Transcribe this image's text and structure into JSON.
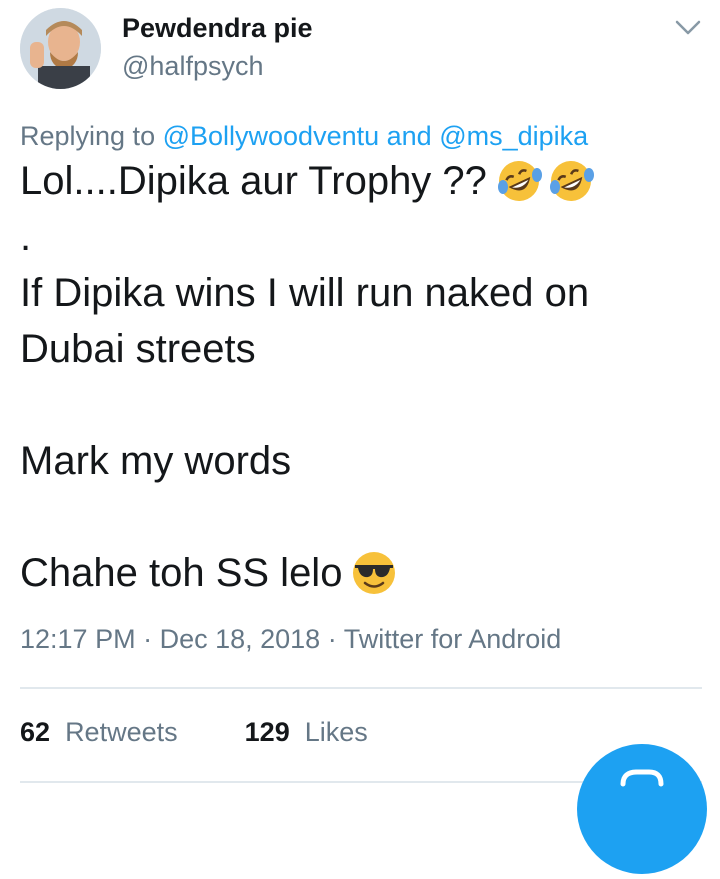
{
  "user": {
    "name": "Pewdendra pie",
    "handle": "@halfpsych"
  },
  "reply": {
    "prefix": "Replying to ",
    "mention1": "@Bollywoodventu",
    "joiner": " and ",
    "mention2": "@ms_dipika"
  },
  "tweet": {
    "line1": "Lol....Dipika aur Trophy ??",
    "line2": ".",
    "line3": "If Dipika wins I will run naked on",
    "line4": "Dubai streets",
    "line6": "Mark my words",
    "line8": "Chahe toh SS lelo"
  },
  "emoji": {
    "laugh": "rolling-on-floor-laughing-icon",
    "cool": "smiling-face-with-sunglasses-icon",
    "colors": {
      "face": "#f7c13a",
      "tear": "#5aa0e6",
      "glasses": "#2b2b2b"
    }
  },
  "meta": {
    "time": "12:17 PM",
    "sep1": " · ",
    "date": "Dec 18, 2018",
    "sep2": " · ",
    "client": "Twitter for Android"
  },
  "stats": {
    "retweets_count": "62",
    "retweets_label": "Retweets",
    "likes_count": "129",
    "likes_label": "Likes"
  },
  "colors": {
    "accent": "#1da1f2",
    "text": "#14171a",
    "muted": "#657786",
    "divider": "#e1e8ed"
  }
}
